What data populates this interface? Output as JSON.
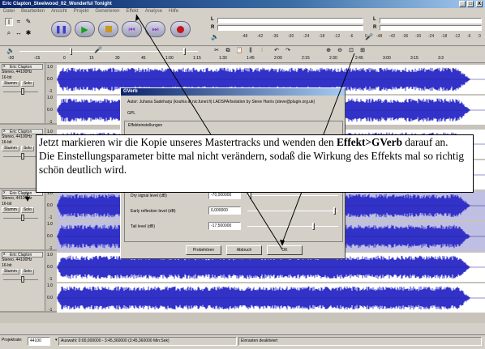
{
  "window": {
    "title": "Eric Clapton_Steelwood_02_Wonderful Tonight",
    "btn_min": "_",
    "btn_max": "□",
    "btn_close": "X"
  },
  "menu": [
    "Datei",
    "Bearbeiten",
    "Ansicht",
    "Projekt",
    "Generieren",
    "Effekt",
    "Analyse",
    "Hilfe"
  ],
  "meters": {
    "left_label": "L",
    "right_label": "R",
    "scale": [
      "-48",
      "-42",
      "-36",
      "-30",
      "-24",
      "-18",
      "-12",
      "-6",
      "0"
    ],
    "scale2": [
      "-48",
      "-42",
      "-36",
      "-30",
      "-24",
      "-18",
      "-12",
      "-6",
      "0"
    ]
  },
  "ruler": [
    "-30",
    "-15",
    "0",
    "15",
    "30",
    "45",
    "1:00",
    "1:15",
    "1:30",
    "1:45",
    "2:00",
    "2:15",
    "2:30",
    "2:45",
    "3:00",
    "3:15",
    "3:3"
  ],
  "tracks": [
    {
      "name": "Eric Clapton",
      "rate": "Stereo, 44100Hz",
      "bits": "16-bit",
      "mute": "Stumm",
      "solo": "Solo",
      "scale_top": "1.0",
      "scale_mid": "0.0",
      "scale_bot": "-1",
      "selected": false
    },
    {
      "name": "Eric Clapton",
      "rate": "Stereo, 44100Hz",
      "bits": "16-bit",
      "mute": "Stumm",
      "solo": "Solo",
      "scale_top": "1.0",
      "scale_mid": "0.0",
      "scale_bot": "-1",
      "selected": false
    },
    {
      "name": "Eric Clapton",
      "rate": "Stereo, 44100Hz",
      "bits": "16-bit",
      "mute": "Stumm",
      "solo": "Solo",
      "scale_top": "1.0",
      "scale_mid": "0.0",
      "scale_bot": "-1",
      "selected": true
    },
    {
      "name": "Eric Clapton",
      "rate": "Stereo, 44100Hz",
      "bits": "16-bit",
      "mute": "Stumm",
      "solo": "Solo",
      "scale_top": "1.0",
      "scale_mid": "0.0",
      "scale_bot": "-1",
      "selected": false
    }
  ],
  "dialog": {
    "title": "GVerb",
    "author": "Autor: Juhana Sadeharju (kouhia at nic.funet.fi) LADSPA/Isolation by Steve Harris (steve@plugin.org.uk)",
    "license": "GPL",
    "group": "Effekteinstellungen",
    "params": [
      {
        "label": "Dry signal level (dB)",
        "value": "-70,000000"
      },
      {
        "label": "Early reflection level (dB)",
        "value": "0,000000"
      },
      {
        "label": "Tail level (dB)",
        "value": "-17,500000"
      }
    ],
    "preview": "Probehören",
    "cancel": "Abbruch",
    "ok": "OK"
  },
  "caption": {
    "part1": "Jetzt markieren wir die Kopie unseres Mastertracks und wenden den ",
    "bold": "Effekt>GVerb",
    "part2": " darauf an.",
    "line2": "Die Einstellungsparameter bitte mal nicht verändern, sodaß die Wirkung des Effekts mal so richtig schön deutlich wird."
  },
  "status": {
    "rate_label": "Projektrate:",
    "rate_value": "44100",
    "selection": "Auswahl: 0:00,000000 - 3:45,360000 (3:45,360000 Min:Sek)",
    "state": "Einrasten deaktiviert"
  }
}
